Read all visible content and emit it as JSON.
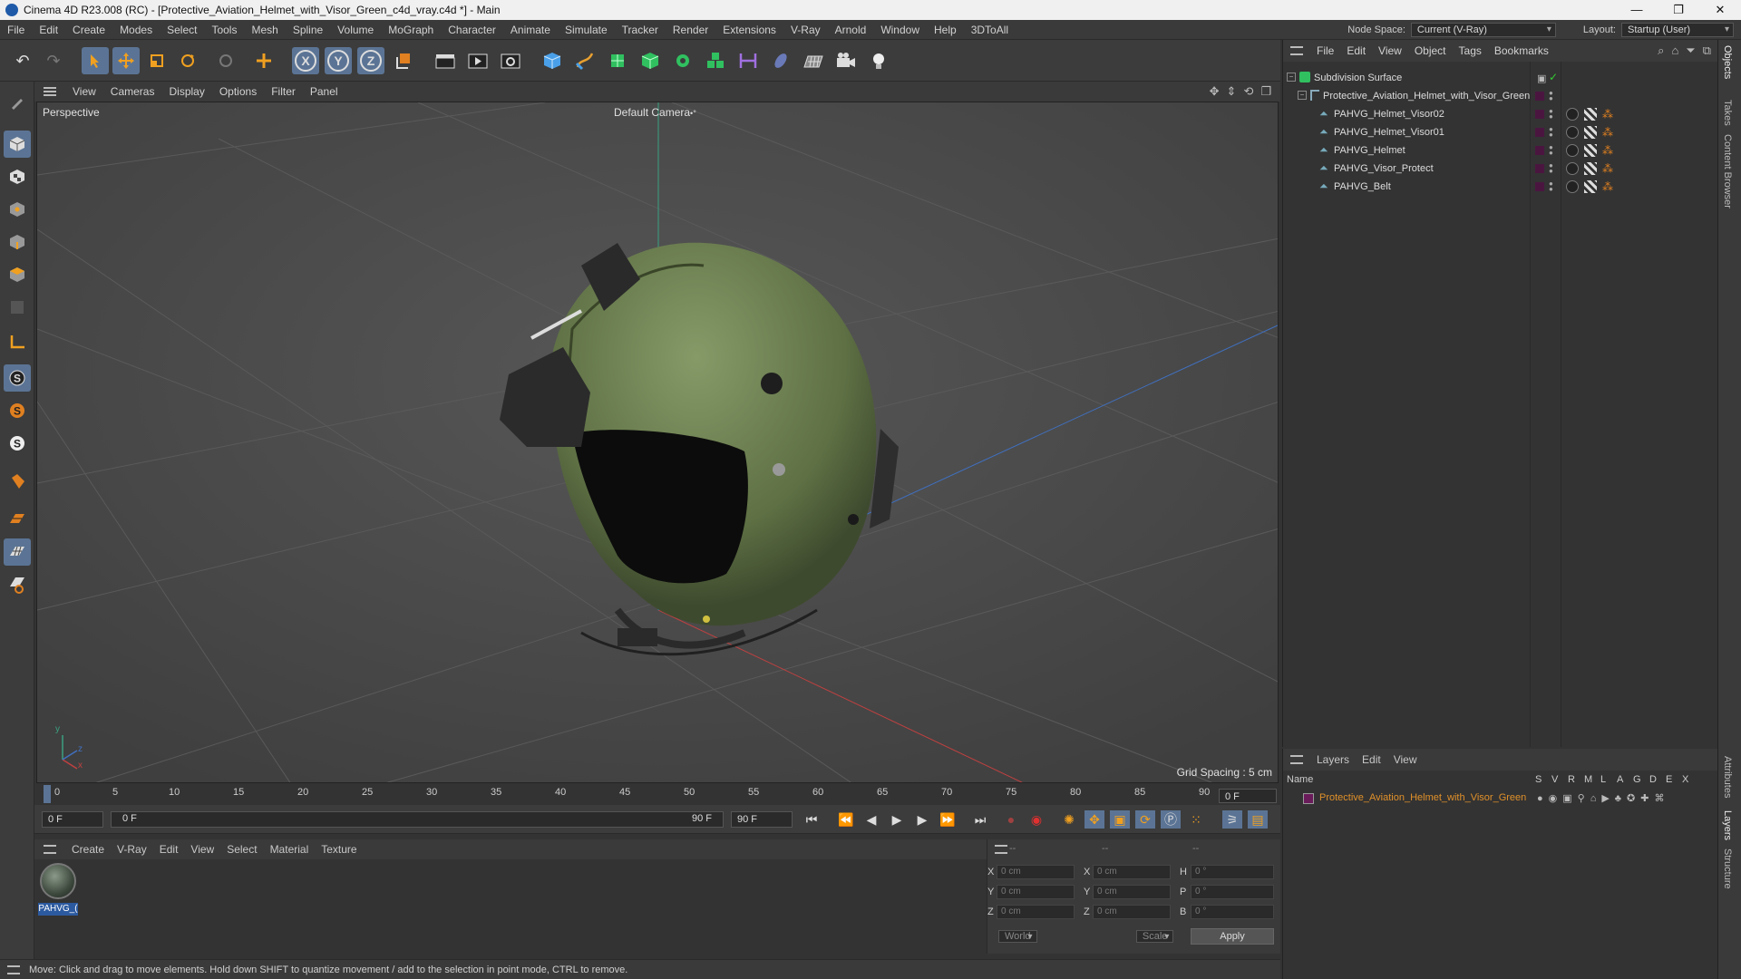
{
  "window": {
    "title": "Cinema 4D R23.008 (RC) - [Protective_Aviation_Helmet_with_Visor_Green_c4d_vray.c4d *] - Main",
    "controls": [
      "—",
      "❐",
      "✕"
    ]
  },
  "menubar": {
    "items": [
      "File",
      "Edit",
      "Create",
      "Modes",
      "Select",
      "Tools",
      "Mesh",
      "Spline",
      "Volume",
      "MoGraph",
      "Character",
      "Animate",
      "Simulate",
      "Tracker",
      "Render",
      "Extensions",
      "V-Ray",
      "Arnold",
      "Window",
      "Help",
      "3DToAll"
    ],
    "node_space_label": "Node Space:",
    "node_space_value": "Current (V-Ray)",
    "layout_label": "Layout:",
    "layout_value": "Startup (User)"
  },
  "toolbar": {
    "undo": "↶",
    "redo": "↷",
    "axis_x": "X",
    "axis_y": "Y",
    "axis_z": "Z"
  },
  "viewport": {
    "menu": [
      "View",
      "Cameras",
      "Display",
      "Options",
      "Filter",
      "Panel"
    ],
    "label": "Perspective",
    "camera": "Default Camera",
    "camera_suffix": "•°",
    "grid_spacing": "Grid Spacing : 5 cm",
    "axis_y": "y",
    "axis_z": "z",
    "axis_x": "x"
  },
  "timeline": {
    "ticks": [
      "0",
      "5",
      "10",
      "15",
      "20",
      "25",
      "30",
      "35",
      "40",
      "45",
      "50",
      "55",
      "60",
      "65",
      "70",
      "75",
      "80",
      "85",
      "90"
    ],
    "current_frame": "0 F"
  },
  "transport": {
    "start_frame": "0 F",
    "range_start": "0 F",
    "range_end": "90 F",
    "end_frame": "90 F"
  },
  "material_manager": {
    "menu": [
      "Create",
      "V-Ray",
      "Edit",
      "View",
      "Select",
      "Material",
      "Texture"
    ],
    "material_name": "PAHVG_("
  },
  "coordinates": {
    "header": [
      "--",
      "--",
      "--"
    ],
    "pos_label_x": "X",
    "pos_label_y": "Y",
    "pos_label_z": "Z",
    "size_label_x": "X",
    "size_label_y": "Y",
    "size_label_z": "Z",
    "rot_label_h": "H",
    "rot_label_p": "P",
    "rot_label_b": "B",
    "pos_x": "0 cm",
    "pos_y": "0 cm",
    "pos_z": "0 cm",
    "size_x": "0 cm",
    "size_y": "0 cm",
    "size_z": "0 cm",
    "rot_h": "0 °",
    "rot_p": "0 °",
    "rot_b": "0 °",
    "mode_world": "World",
    "mode_scale": "Scale",
    "apply": "Apply"
  },
  "status": {
    "text": "Move: Click and drag to move elements. Hold down SHIFT to quantize movement / add to the selection in point mode, CTRL to remove."
  },
  "objects_panel": {
    "menu": [
      "File",
      "Edit",
      "View",
      "Object",
      "Tags",
      "Bookmarks"
    ],
    "rows": [
      {
        "name": "Subdivision Surface"
      },
      {
        "name": "Protective_Aviation_Helmet_with_Visor_Green"
      },
      {
        "name": "PAHVG_Helmet_Visor02"
      },
      {
        "name": "PAHVG_Helmet_Visor01"
      },
      {
        "name": "PAHVG_Helmet"
      },
      {
        "name": "PAHVG_Visor_Protect"
      },
      {
        "name": "PAHVG_Belt"
      }
    ]
  },
  "layers_panel": {
    "menu": [
      "Layers",
      "Edit",
      "View"
    ],
    "col_name": "Name",
    "cols": [
      "S",
      "V",
      "R",
      "M",
      "L",
      "A",
      "G",
      "D",
      "E",
      "X"
    ],
    "layer_name": "Protective_Aviation_Helmet_with_Visor_Green",
    "layer_color": "#6a1b5a"
  },
  "side_tabs": [
    "Objects",
    "Takes",
    "Content Browser",
    "Attributes",
    "Layers",
    "Structure"
  ],
  "colors": {
    "accent_blue": "#5b7495",
    "helmet_green": "#6b7f4f",
    "layer_text": "#e0902a"
  }
}
